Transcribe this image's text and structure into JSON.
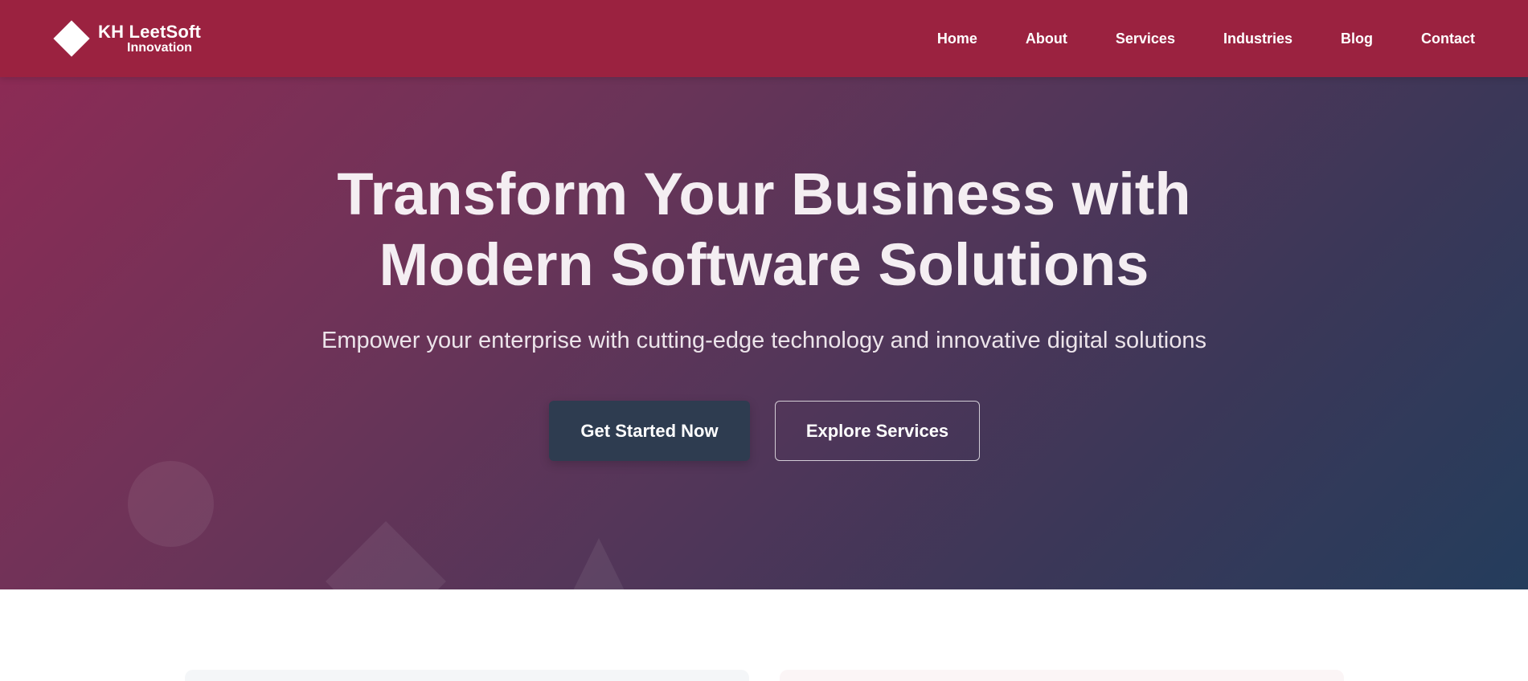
{
  "header": {
    "brand_name": "KH LeetSoft",
    "brand_tagline": "Innovation",
    "nav": [
      {
        "label": "Home"
      },
      {
        "label": "About"
      },
      {
        "label": "Services"
      },
      {
        "label": "Industries"
      },
      {
        "label": "Blog"
      },
      {
        "label": "Contact"
      }
    ]
  },
  "hero": {
    "title_line1": "Transform Your Business with",
    "title_line2": "Modern Software Solutions",
    "subtitle": "Empower your enterprise with cutting-edge technology and innovative digital solutions",
    "primary_button": "Get Started Now",
    "secondary_button": "Explore Services"
  },
  "colors": {
    "header_bg": "#9b2240",
    "hero_gradient_start": "#8c2b55",
    "hero_gradient_end": "#243d5c",
    "primary_button_bg": "#2e3c50"
  },
  "icons": {
    "logo": "white-diamond-icon",
    "decorations": [
      "circle-shape",
      "diamond-shape",
      "triangle-shape"
    ]
  }
}
